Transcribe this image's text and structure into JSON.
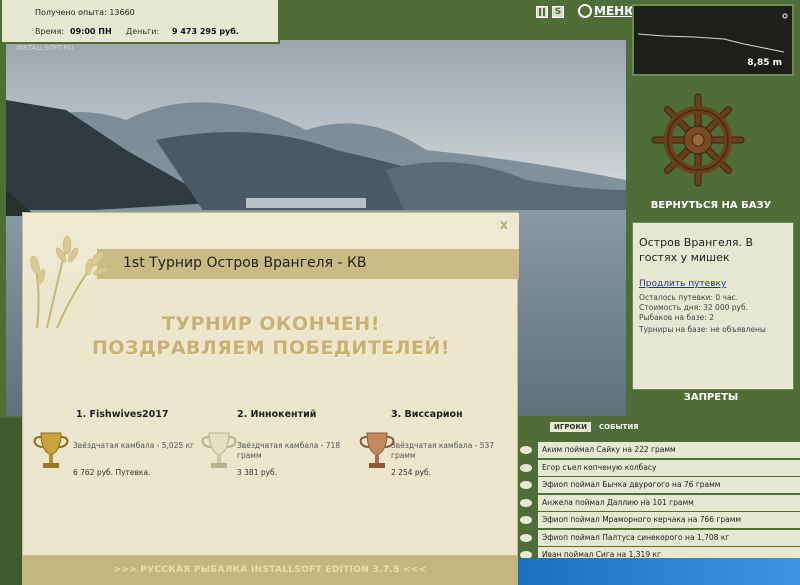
{
  "player": {
    "experience_label": "Получено опыта: 13660",
    "time_label": "Время:",
    "time_value": "09:00 ПН",
    "money_label": "Деньги:",
    "money_value": "9 473 295 руб."
  },
  "watermark": "INSTALLSOFT.RU",
  "topbar": {
    "pause_icon": "pause-icon",
    "s_icon_label": "S",
    "menu_label": "МЕНЮ"
  },
  "depth": {
    "value": "8,85 m"
  },
  "base": {
    "return_label": "ВЕРНУТЬСЯ НА БАЗУ",
    "title": "Остров Врангеля. В гостях у мишек",
    "extend_link": "Продлить путевку",
    "lines": [
      "Осталось путевки: 0 час.",
      "Стоимость дня: 32 000 руб.",
      "Рыбаков на базе: 2",
      "Турниры на базе: не объявлены"
    ],
    "bans_label": "ЗАПРЕТЫ"
  },
  "events": {
    "tabs": [
      {
        "label": "ИГРОКИ"
      },
      {
        "label": "СОБЫТИЯ"
      }
    ],
    "items": [
      "Аким поймал Сайку на 222 грамм",
      "Егор съел копченую колбасу",
      "Эфиоп поймал Бычка двурогого на 76 грамм",
      "Анжела поймал Даллию на 101 грамм",
      "Эфиоп поймал Мраморного керчака на 766 грамм",
      "Эфиоп поймал Палтуса синекорого на 1,708 кг",
      "Иван поймал Сига на 1,319 кг"
    ]
  },
  "modal": {
    "title": "1st Турнир Остров Врангеля - КВ",
    "close_label": "x",
    "headline1": "ТУРНИР ОКОНЧЕН!",
    "headline2": "ПОЗДРАВЛЯЕМ ПОБЕДИТЕЛЕЙ!",
    "winners": [
      {
        "name": "1. Fishwives2017",
        "fish": "Звёздчатая камбала - 5,025 кг",
        "prize": "6 762 руб. Путевка.",
        "cup": "gold"
      },
      {
        "name": "2. Иннокентий",
        "fish": "Звёздчатая камбала - 718 грамм",
        "prize": "3 381 руб.",
        "cup": "silver"
      },
      {
        "name": "3. Виссарион",
        "fish": "Звёздчатая камбала - 537 грамм",
        "prize": "2 254 руб.",
        "cup": "bronze"
      }
    ],
    "footer": ">>> РУССКАЯ РЫБАЛКА INSTALLSOFT EDITION 3.7.5 <<<"
  },
  "colors": {
    "panel_green": "#4e6d37",
    "cream": "#e7e8d2",
    "gold_text": "#c7b274"
  }
}
